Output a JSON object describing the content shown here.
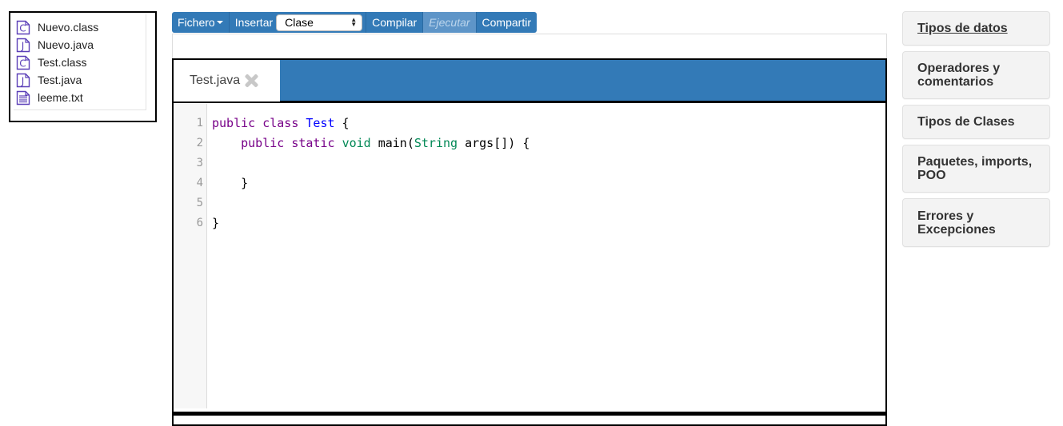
{
  "file_browser": {
    "files": [
      {
        "name": "Nuevo.class",
        "icon": "class-file-icon",
        "letter": "C"
      },
      {
        "name": "Nuevo.java",
        "icon": "java-file-icon",
        "letter": "J"
      },
      {
        "name": "Test.class",
        "icon": "class-file-icon",
        "letter": "C"
      },
      {
        "name": "Test.java",
        "icon": "java-file-icon",
        "letter": "J"
      },
      {
        "name": "leeme.txt",
        "icon": "text-file-icon",
        "letter": ""
      }
    ]
  },
  "toolbar": {
    "file_label": "Fichero",
    "insert_label": "Insertar",
    "insert_select_value": "Clase",
    "compile_label": "Compilar",
    "run_label": "Ejecutar",
    "share_label": "Compartir"
  },
  "editor": {
    "tab_label": "Test.java",
    "line_numbers": [
      "1",
      "2",
      "3",
      "4",
      "5",
      "6"
    ],
    "code_lines": [
      [
        {
          "t": "public class ",
          "c": "kw"
        },
        {
          "t": "Test",
          "c": "def"
        },
        {
          "t": " {",
          "c": ""
        }
      ],
      [
        {
          "t": "    public static ",
          "c": "kw"
        },
        {
          "t": "void",
          "c": "var3"
        },
        {
          "t": " main(",
          "c": ""
        },
        {
          "t": "String",
          "c": "var3"
        },
        {
          "t": " args[]) {",
          "c": ""
        }
      ],
      [],
      [
        {
          "t": "    }",
          "c": ""
        }
      ],
      [],
      [
        {
          "t": "}",
          "c": ""
        }
      ]
    ]
  },
  "sidebar": {
    "items": [
      {
        "label": "Tipos de datos",
        "active": true
      },
      {
        "label": "Operadores y comentarios",
        "active": false
      },
      {
        "label": "Tipos de Clases",
        "active": false
      },
      {
        "label": "Paquetes, imports, POO",
        "active": false
      },
      {
        "label": "Errores y Excepciones",
        "active": false
      }
    ]
  },
  "colors": {
    "accent": "#337ab7",
    "icon": "#5b3fb8",
    "keyword": "#770088",
    "definition": "#0000ff",
    "type": "#008855"
  }
}
